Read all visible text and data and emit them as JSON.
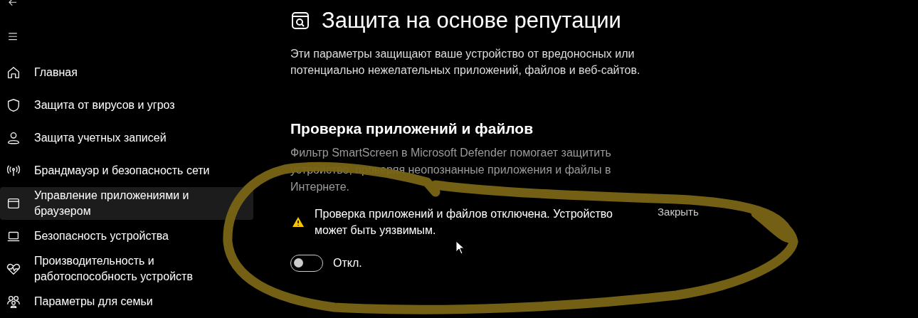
{
  "sidebar": {
    "items": [
      {
        "label": "Главная",
        "kind": "home",
        "selected": false
      },
      {
        "label": "Защита от вирусов и угроз",
        "kind": "shield",
        "selected": false
      },
      {
        "label": "Защита учетных записей",
        "kind": "person",
        "selected": false
      },
      {
        "label": "Брандмауэр и безопасность сети",
        "kind": "antenna",
        "selected": false
      },
      {
        "label": "Управление приложениями и браузером",
        "kind": "window",
        "selected": true
      },
      {
        "label": "Безопасность устройства",
        "kind": "laptop",
        "selected": false
      },
      {
        "label": "Производительность и работоспособность устройств",
        "kind": "heart",
        "selected": false
      },
      {
        "label": "Параметры для семьи",
        "kind": "family",
        "selected": false
      }
    ]
  },
  "page": {
    "title": "Защита на основе репутации",
    "description": "Эти параметры защищают ваше устройство от вредоносных или потенциально нежелательных приложений, файлов и веб-сайтов."
  },
  "section": {
    "heading": "Проверка приложений и файлов",
    "description": "Фильтр SmartScreen в Microsoft Defender помогает защитить устройство, проверяя неопознанные приложения и файлы в Интернете.",
    "warning": {
      "text": "Проверка приложений и файлов отключена. Устройство может быть уязвимым.",
      "dismiss": "Закрыть"
    },
    "toggle": {
      "on": false,
      "label": "Откл."
    }
  }
}
